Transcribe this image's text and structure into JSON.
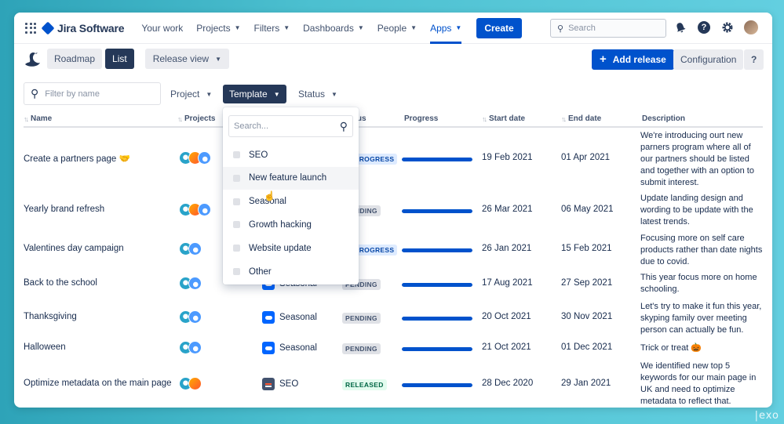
{
  "nav": {
    "app_name": "Jira Software",
    "items": [
      {
        "label": "Your work",
        "has_chevron": false
      },
      {
        "label": "Projects",
        "has_chevron": true
      },
      {
        "label": "Filters",
        "has_chevron": true
      },
      {
        "label": "Dashboards",
        "has_chevron": true
      },
      {
        "label": "People",
        "has_chevron": true
      },
      {
        "label": "Apps",
        "has_chevron": true,
        "active": true
      }
    ],
    "create_label": "Create",
    "search_placeholder": "Search"
  },
  "subbar": {
    "roadmap_label": "Roadmap",
    "list_label": "List",
    "release_view_label": "Release view",
    "add_release_label": "Add release",
    "configuration_label": "Configuration",
    "help_label": "?"
  },
  "filters": {
    "name_placeholder": "Filter by name",
    "project_label": "Project",
    "template_label": "Template",
    "status_label": "Status"
  },
  "table": {
    "headers": {
      "name": "Name",
      "projects": "Projects",
      "status": "Status",
      "progress": "Progress",
      "start": "Start date",
      "end": "End date",
      "description": "Description"
    },
    "rows": [
      {
        "name": "Create a partners page 🤝",
        "avatars": [
          "teal",
          "orange",
          "blue"
        ],
        "template": "",
        "status": "IN PROGRESS",
        "progress": 1.0,
        "start": "19 Feb 2021",
        "end": "01 Apr 2021",
        "description": "We're introducing ourt new parners program where all of our partners should be listed and together with an option to submit interest."
      },
      {
        "name": "Yearly brand refresh",
        "avatars": [
          "teal",
          "orange",
          "blue"
        ],
        "template": "",
        "status": "PENDING",
        "progress": 1.0,
        "start": "26 Mar 2021",
        "end": "06 May 2021",
        "description": "Update landing design and wording to be update with the latest trends."
      },
      {
        "name": "Valentines day campaign",
        "avatars": [
          "teal",
          "blue"
        ],
        "template": "",
        "status": "IN PROGRESS",
        "progress": 1.0,
        "start": "26 Jan 2021",
        "end": "15 Feb 2021",
        "description": "Focusing more on self care products rather than date nights due to covid."
      },
      {
        "name": "Back to the school",
        "avatars": [
          "teal",
          "blue"
        ],
        "template": "Seasonal",
        "status": "PENDING",
        "progress": 1.0,
        "start": "17 Aug 2021",
        "end": "27 Sep 2021",
        "description": "This year focus more on home schooling."
      },
      {
        "name": "Thanksgiving",
        "avatars": [
          "teal",
          "blue"
        ],
        "template": "Seasonal",
        "status": "PENDING",
        "progress": 1.0,
        "start": "20 Oct 2021",
        "end": "30 Nov 2021",
        "description": "Let's try to make it fun this year, skyping family over meeting person can actually be fun."
      },
      {
        "name": "Halloween",
        "avatars": [
          "teal",
          "blue"
        ],
        "template": "Seasonal",
        "status": "PENDING",
        "progress": 1.0,
        "start": "21 Oct 2021",
        "end": "01 Dec 2021",
        "description": "Trick or treat 🎃"
      },
      {
        "name": "Optimize metadata on the main page",
        "avatars": [
          "teal",
          "orange"
        ],
        "template": "SEO",
        "status": "RELEASED",
        "progress": 1.0,
        "start": "28 Dec 2020",
        "end": "29 Jan 2021",
        "description": "We identified new top 5 keywords for our main page in UK and need to optimize metadata to reflect that."
      }
    ]
  },
  "template_dropdown": {
    "search_placeholder": "Search...",
    "options": [
      "SEO",
      "New feature launch",
      "Seasonal",
      "Growth hacking",
      "Website update",
      "Other"
    ],
    "hovered": "New feature launch"
  },
  "watermark": "|exo",
  "colors": {
    "brand": "#0052cc",
    "nav_dark": "#253858",
    "background_teal": "#4cc0d0"
  }
}
